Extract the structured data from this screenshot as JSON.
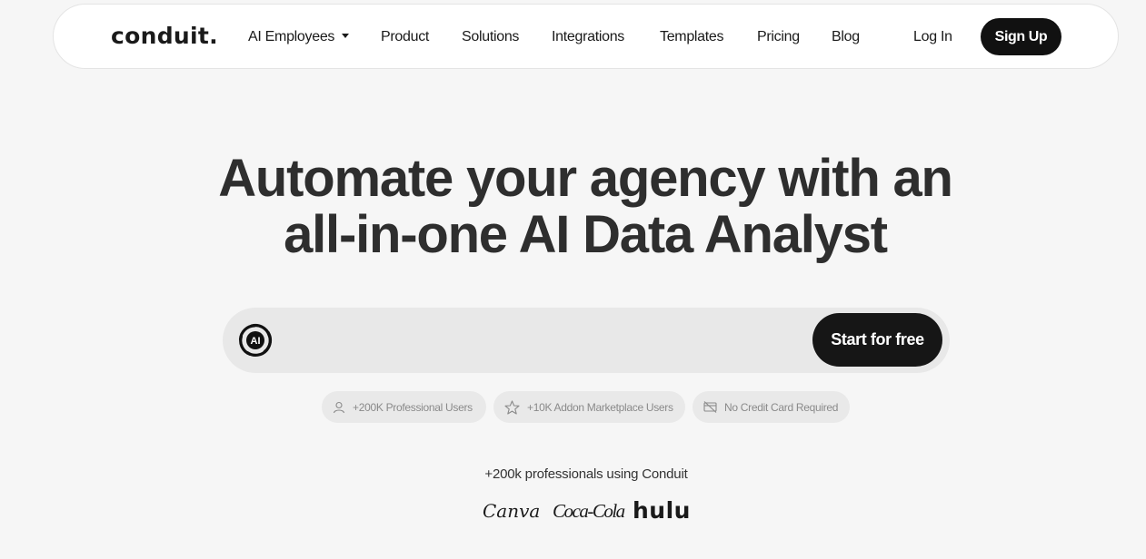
{
  "nav": {
    "logo": "conduit.",
    "items": [
      {
        "label": "AI Employees",
        "has_dropdown": true
      },
      {
        "label": "Product"
      },
      {
        "label": "Solutions"
      },
      {
        "label": "Integrations"
      },
      {
        "label": "Templates"
      },
      {
        "label": "Pricing"
      },
      {
        "label": "Blog"
      }
    ],
    "login_label": "Log In",
    "signup_label": "Sign Up"
  },
  "hero": {
    "headline_line1": "Automate your agency with an",
    "headline_line2": "all-in-one AI Data Analyst"
  },
  "prompt": {
    "icon": "ai-swirl-icon",
    "placeholder": "",
    "cta_label": "Start for free"
  },
  "badges": [
    {
      "icon": "user-icon",
      "label": "+200K Professional Users"
    },
    {
      "icon": "star-icon",
      "label": "+10K Addon Marketplace Users"
    },
    {
      "icon": "no-card-icon",
      "label": "No Credit Card Required"
    }
  ],
  "social_proof": {
    "text": "+200k professionals using Conduit",
    "brands": [
      "Canva",
      "Coca-Cola",
      "hulu"
    ]
  },
  "colors": {
    "page_background": "#f6f6f6",
    "primary_button": "#111111",
    "input_background": "#e8e8e8",
    "badge_background": "#e9e9e9",
    "badge_text": "#8a8a8a"
  }
}
